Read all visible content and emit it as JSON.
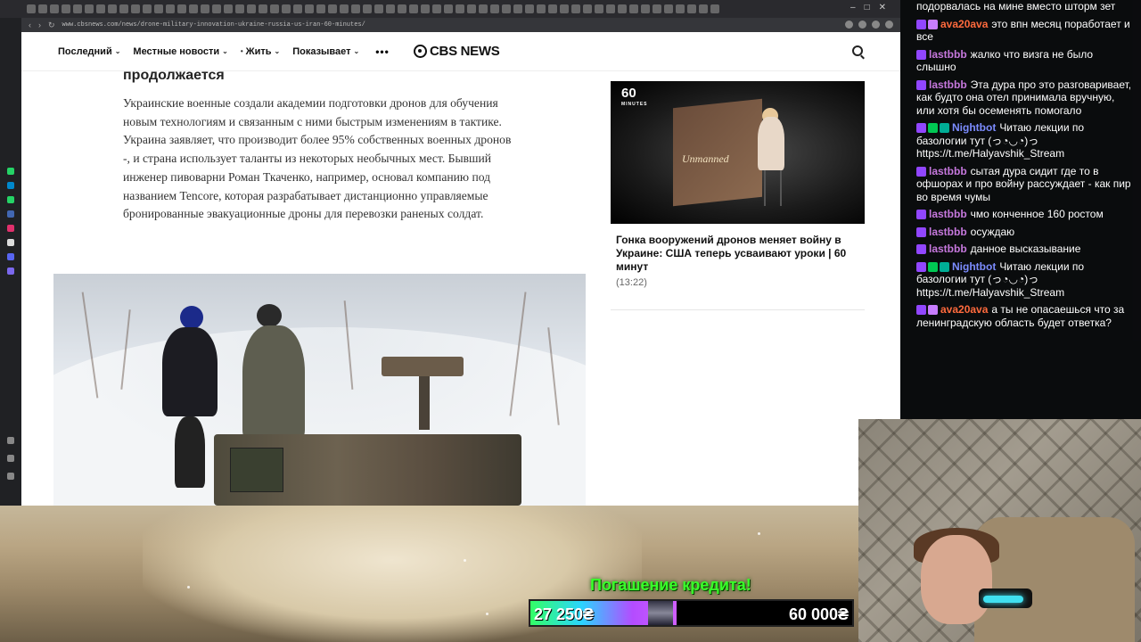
{
  "browser": {
    "url": "www.cbsnews.com/news/drone-military-innovation-ukraine-russia-us-iran-60-minutes/"
  },
  "site": {
    "logo": "CBS NEWS",
    "nav": [
      {
        "label": "Последний"
      },
      {
        "label": "Местные новости"
      },
      {
        "label": "Жить"
      },
      {
        "label": "Показывает"
      }
    ],
    "more": "•••"
  },
  "article": {
    "heading": "продолжается",
    "paragraph": "Украинские военные создали академии подготовки дронов для обучения новым технологиям и связанным с ними быстрым изменениям в тактике. Украина заявляет, что производит более 95% собственных военных дронов -, и страна использует таланты из некоторых необычных мест. Бывший инженер пивоварни Роман Ткаченко, например, основал компанию под названием Tencore, которая разрабатывает дистанционно управляемые бронированные эвакуационные дроны для перевозки раненых солдат."
  },
  "video": {
    "badge_main": "60",
    "badge_sub": "MINUTES",
    "book_text": "Unmanned",
    "title": "Гонка вооружений дронов меняет войну в Украине: США теперь усваивают уроки | 60 минут",
    "duration": "(13:22)"
  },
  "chat": [
    {
      "user": "",
      "color": "#ffffff",
      "badges": [],
      "text": "подорвалась на мине вместо шторм зет"
    },
    {
      "user": "ava20ava",
      "color": "#ff6a3d",
      "badges": [
        "#9146ff",
        "#c77dff"
      ],
      "text": "это впн месяц поработает и все"
    },
    {
      "user": "lastbbb",
      "color": "#c678dd",
      "badges": [
        "#9146ff"
      ],
      "text": "жалко что визга не было слышно"
    },
    {
      "user": "lastbbb",
      "color": "#c678dd",
      "badges": [
        "#9146ff"
      ],
      "text": "Эта дура про это разговаривает, как будто она отел принимала вручную, или хотя бы осеменять помогало"
    },
    {
      "user": "Nightbot",
      "color": "#7c8cff",
      "badges": [
        "#9146ff",
        "#00c853",
        "#00ad96"
      ],
      "text": "Читаю лекции по базологии тут (っ◔◡◔)っ https://t.me/Halyavshik_Stream"
    },
    {
      "user": "lastbbb",
      "color": "#c678dd",
      "badges": [
        "#9146ff"
      ],
      "text": "сытая дура сидит где то в офшорах и про войну рассуждает - как пир во время чумы"
    },
    {
      "user": "lastbbb",
      "color": "#c678dd",
      "badges": [
        "#9146ff"
      ],
      "text": "чмо конченное 160 ростом"
    },
    {
      "user": "lastbbb",
      "color": "#c678dd",
      "badges": [
        "#9146ff"
      ],
      "text": "осуждаю"
    },
    {
      "user": "lastbbb",
      "color": "#c678dd",
      "badges": [
        "#9146ff"
      ],
      "text": "данное высказывание"
    },
    {
      "user": "Nightbot",
      "color": "#7c8cff",
      "badges": [
        "#9146ff",
        "#00c853",
        "#00ad96"
      ],
      "text": "Читаю лекции по базологии тут (っ◔◡◔)っ https://t.me/Halyavshik_Stream"
    },
    {
      "user": "ava20ava",
      "color": "#ff6a3d",
      "badges": [
        "#9146ff",
        "#c77dff"
      ],
      "text": "а ты не опасаешься что за ленинградскую область будет ответка?"
    }
  ],
  "goal": {
    "title": "Погашение кредита!",
    "current": "27 250₴",
    "target": "60 000₴",
    "progress": 0.454
  },
  "colors": {
    "goal_title": "#39ff2a",
    "page_bg": "#ffffff"
  }
}
